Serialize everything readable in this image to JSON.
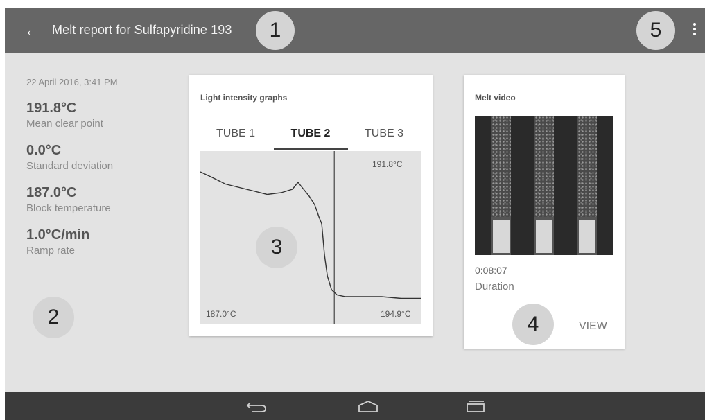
{
  "app_bar": {
    "back_icon": "arrow-back-icon",
    "title": "Melt report for Sulfapyridine 193",
    "menu_icon": "overflow-menu-icon"
  },
  "callouts": [
    "1",
    "2",
    "3",
    "4",
    "5"
  ],
  "summary": {
    "date": "22 April 2016, 3:41 PM",
    "stats": [
      {
        "value": "191.8°C",
        "label": "Mean clear point"
      },
      {
        "value": "0.0°C",
        "label": "Standard deviation"
      },
      {
        "value": "187.0°C",
        "label": "Block temperature"
      },
      {
        "value": "1.0°C/min",
        "label": "Ramp rate"
      }
    ]
  },
  "graph_card": {
    "title": "Light intensity graphs",
    "tabs": [
      "TUBE 1",
      "TUBE 2",
      "TUBE 3"
    ],
    "active_tab": "TUBE 2",
    "x_start_label": "187.0°C",
    "x_end_label": "194.9°C",
    "marker_label": "191.8°C"
  },
  "chart_data": {
    "type": "line",
    "x_range": [
      187.0,
      194.9
    ],
    "clear_point": 191.8,
    "series": [
      {
        "x": [
          187.0,
          187.4,
          187.9,
          188.4,
          188.9,
          189.4,
          189.9,
          190.3,
          190.5,
          190.7,
          190.9,
          191.1,
          191.25,
          191.35,
          191.45,
          191.55,
          191.7,
          191.9,
          192.2,
          192.8,
          193.5,
          194.2,
          194.9
        ],
        "y": [
          0.88,
          0.85,
          0.81,
          0.79,
          0.77,
          0.75,
          0.76,
          0.78,
          0.82,
          0.78,
          0.74,
          0.69,
          0.62,
          0.58,
          0.4,
          0.28,
          0.2,
          0.17,
          0.16,
          0.16,
          0.16,
          0.15,
          0.15
        ]
      }
    ]
  },
  "video_card": {
    "title": "Melt video",
    "time": "0:08:07",
    "time_label": "Duration",
    "view_label": "VIEW"
  },
  "nav_bar": {
    "icons": [
      "back-nav-icon",
      "home-nav-icon",
      "recents-nav-icon"
    ]
  }
}
